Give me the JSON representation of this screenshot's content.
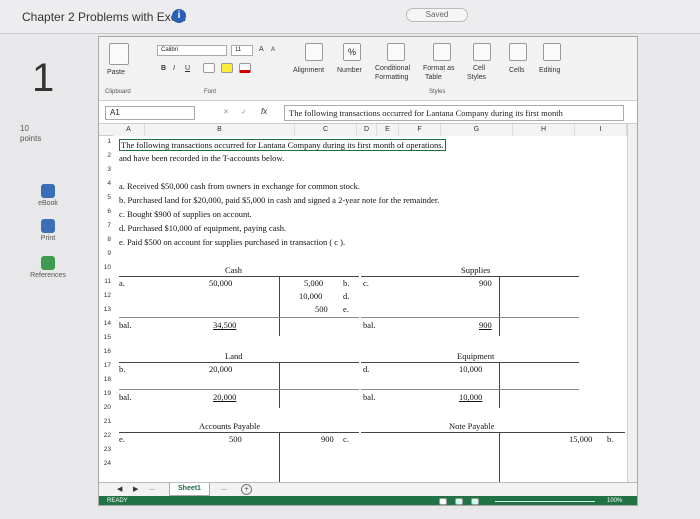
{
  "header": {
    "title": "Chapter 2 Problems with Excel",
    "info_icon": "i",
    "saved": "Saved"
  },
  "question": {
    "number": "1",
    "points_value": "10",
    "points_label": "points"
  },
  "sidebar": {
    "items": [
      {
        "label": "eBook",
        "icon": "book-icon"
      },
      {
        "label": "Print",
        "icon": "printer-icon"
      },
      {
        "label": "References",
        "icon": "references-icon"
      }
    ]
  },
  "ribbon": {
    "paste": "Paste",
    "clipboard": "Clipboard",
    "font_name": "Calibri",
    "font_size": "11",
    "font_group": "Font",
    "bold": "B",
    "italic": "I",
    "underline": "U",
    "grow": "A",
    "shrink": "A",
    "alignment": "Alignment",
    "number": "Number",
    "percent": "%",
    "conditional": "Conditional",
    "formatting": "Formatting",
    "format_as": "Format as",
    "table": "Table",
    "cell": "Cell",
    "styles_btn": "Styles",
    "styles": "Styles",
    "cells": "Cells",
    "editing": "Editing"
  },
  "formula_bar": {
    "name_box": "A1",
    "fx": "fx",
    "content": "The following transactions occurred for Lantana Company during its first month"
  },
  "columns": [
    "A",
    "B",
    "C",
    "D",
    "E",
    "F",
    "G",
    "H",
    "I"
  ],
  "rows": [
    "1",
    "2",
    "3",
    "4",
    "5",
    "6",
    "7",
    "8",
    "9",
    "10",
    "11",
    "12",
    "13",
    "14",
    "15",
    "16",
    "17",
    "18",
    "19",
    "20",
    "21",
    "22",
    "23",
    "24"
  ],
  "sheet": {
    "intro1": "The following transactions occurred for Lantana Company during its first month of operations.",
    "intro2": "and have been recorded in the T-accounts below.",
    "t_a": "a. Received $50,000 cash from owners in exchange for common stock.",
    "t_b": "b. Purchased land for $20,000, paid $5,000 in cash and signed a 2-year note for the remainder.",
    "t_c": "c. Bought $900 of supplies on account.",
    "t_d": "d. Purchased $10,000 of equipment, paying cash.",
    "t_e": "e. Paid $500 on account for supplies purchased in transaction ( c )."
  },
  "taccounts": {
    "cash": {
      "title": "Cash",
      "debit": "50,000",
      "credits": [
        "5,000",
        "10,000",
        "500"
      ],
      "credit_refs": [
        "b.",
        "d.",
        "e."
      ],
      "debit_ref": "a.",
      "bal_label": "bal.",
      "bal": "34,500"
    },
    "supplies": {
      "title": "Supplies",
      "debit": "900",
      "debit_ref": "c.",
      "bal_label": "bal.",
      "bal": "900"
    },
    "land": {
      "title": "Land",
      "debit": "20,000",
      "debit_ref": "b.",
      "bal_label": "bal.",
      "bal": "20,000"
    },
    "equipment": {
      "title": "Equipment",
      "debit": "10,000",
      "debit_ref": "d.",
      "bal_label": "bal.",
      "bal": "10,000"
    },
    "ap": {
      "title": "Accounts Payable",
      "debit": "500",
      "debit_ref": "e.",
      "credit": "900",
      "credit_ref": "c."
    },
    "np": {
      "title": "Note Payable",
      "credit": "15,000",
      "credit_ref": "b."
    }
  },
  "tabs": {
    "sheet1": "Sheet1",
    "more": "...",
    "add": "+"
  },
  "status": {
    "ready": "READY",
    "zoom": "100%"
  }
}
